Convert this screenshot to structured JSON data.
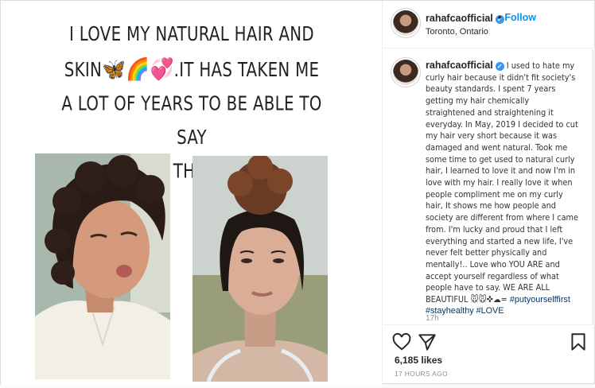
{
  "post_image": {
    "quote_line1": "I LOVE MY NATURAL HAIR AND",
    "quote_line2_start": "SKIN",
    "quote_emojis": "🦋🌈💞",
    "quote_line2_end": ".IT HAS TAKEN ME",
    "quote_line3": "A LOT OF YEARS TO BE ABLE TO SAY",
    "quote_line4": "THIS"
  },
  "header": {
    "username": "rahafcaofficial",
    "follow_label": "Follow",
    "location": "Toronto, Ontario"
  },
  "caption": {
    "username": "rahafcaofficial",
    "text": "I used to hate my curly hair because it didn't fit society's beauty standards. I spent 7 years getting my hair chemically straightened and straightening it everyday. In May, 2019 I decided to cut my hair very short because it was damaged and went natural. Took me some time to get used to natural curly hair, I learned to love it and now I'm in love with my hair. I really love it when people compliment me on my curly hair, It shows me how people and society are different from where I came from. I'm lucky and proud that I left everything and started a new life, I've never felt better physically and mentally!.. Love who YOU ARE and accept yourself regardless of what people have to say. WE ARE ALL BEAUTIFUL 🐭🐭✜☁=",
    "hashtags": [
      "#putyourselffirst",
      "#stayhealthy",
      "#LOVE"
    ],
    "time": "17h"
  },
  "actions": {
    "likes": "6,185 likes",
    "posted": "17 HOURS AGO"
  },
  "icons": [
    "heart-icon",
    "comment-icon",
    "bookmark-icon",
    "verified-icon"
  ],
  "colors": {
    "accent": "#0095f6",
    "verified": "#3897f0",
    "hashtag": "#00376b"
  }
}
